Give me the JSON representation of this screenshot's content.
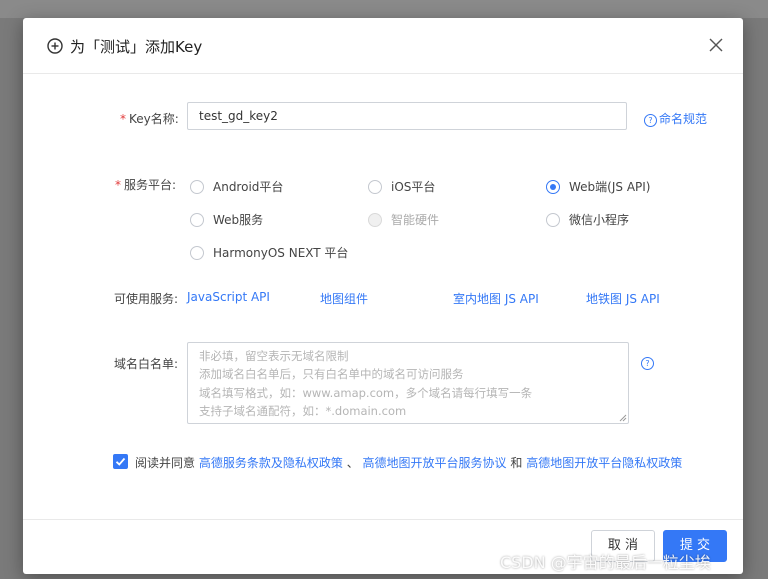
{
  "dialog": {
    "title": "为「测试」添加Key",
    "close_label": "×"
  },
  "key_name": {
    "label": "Key名称:",
    "value": "test_gd_key2",
    "help_link": "命名规范"
  },
  "platform": {
    "label": "服务平台:",
    "options": [
      {
        "label": "Android平台",
        "checked": false,
        "disabled": false
      },
      {
        "label": "iOS平台",
        "checked": false,
        "disabled": false
      },
      {
        "label": "Web端(JS API)",
        "checked": true,
        "disabled": false
      },
      {
        "label": "Web服务",
        "checked": false,
        "disabled": false
      },
      {
        "label": "智能硬件",
        "checked": false,
        "disabled": true
      },
      {
        "label": "微信小程序",
        "checked": false,
        "disabled": false
      },
      {
        "label": "HarmonyOS NEXT 平台",
        "checked": false,
        "disabled": false
      }
    ]
  },
  "services": {
    "label": "可使用服务:",
    "items": [
      "JavaScript API",
      "地图组件",
      "室内地图 JS API",
      "地铁图 JS API"
    ]
  },
  "whitelist": {
    "label": "域名白名单:",
    "value": "",
    "placeholder_lines": [
      "非必填，留空表示无域名限制",
      "添加域名白名单后，只有白名单中的域名可访问服务",
      "域名填写格式，如：www.amap.com，多个域名请每行填写一条",
      "支持子域名通配符，如：*.domain.com"
    ]
  },
  "agreement": {
    "checked": true,
    "prefix": "阅读并同意",
    "link1": "高德服务条款及隐私权政策",
    "sep": "、",
    "link2": "高德地图开放平台服务协议",
    "and": "和",
    "link3": "高德地图开放平台隐私权政策"
  },
  "footer": {
    "cancel_label": "取 消",
    "submit_label": "提 交"
  },
  "watermark": "CSDN @宇宙的最后一粒尘埃",
  "colors": {
    "accent": "#3478f6",
    "required": "#e23b3b",
    "overlay": "#7a7a7a"
  }
}
